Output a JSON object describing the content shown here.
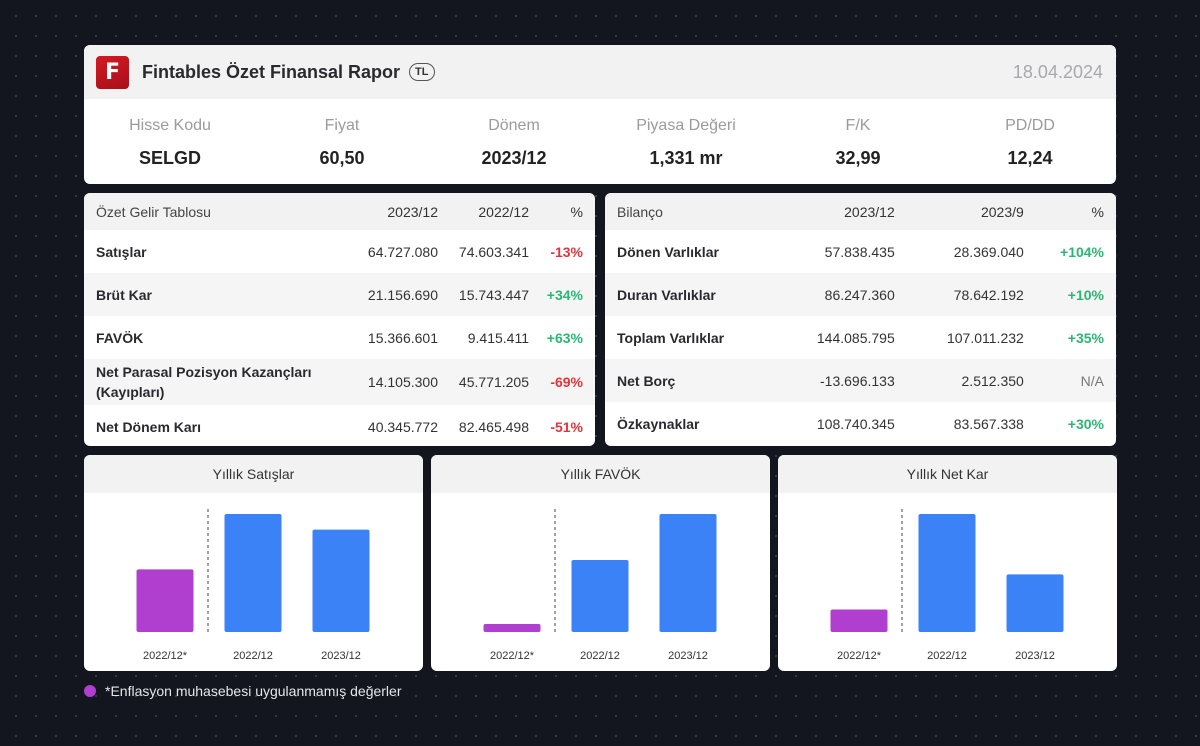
{
  "header": {
    "logo_letter": "F",
    "title": "Fintables Özet Finansal Rapor",
    "currency": "TL",
    "date": "18.04.2024"
  },
  "summary": [
    {
      "label": "Hisse Kodu",
      "value": "SELGD"
    },
    {
      "label": "Fiyat",
      "value": "60,50"
    },
    {
      "label": "Dönem",
      "value": "2023/12"
    },
    {
      "label": "Piyasa Değeri",
      "value": "1,331 mr"
    },
    {
      "label": "F/K",
      "value": "32,99"
    },
    {
      "label": "PD/DD",
      "value": "12,24"
    }
  ],
  "income": {
    "title": "Özet Gelir Tablosu",
    "col1": "2023/12",
    "col2": "2022/12",
    "col3": "%",
    "rows": [
      {
        "name": "Satışlar",
        "v1": "64.727.080",
        "v2": "74.603.341",
        "pct": "-13%"
      },
      {
        "name": "Brüt Kar",
        "v1": "21.156.690",
        "v2": "15.743.447",
        "pct": "+34%"
      },
      {
        "name": "FAVÖK",
        "v1": "15.366.601",
        "v2": "9.415.411",
        "pct": "+63%"
      },
      {
        "name": "Net Parasal Pozisyon Kazançları (Kayıpları)",
        "v1": "14.105.300",
        "v2": "45.771.205",
        "pct": "-69%"
      },
      {
        "name": "Net Dönem Karı",
        "v1": "40.345.772",
        "v2": "82.465.498",
        "pct": "-51%"
      }
    ]
  },
  "balance": {
    "title": "Bilanço",
    "col1": "2023/12",
    "col2": "2023/9",
    "col3": "%",
    "rows": [
      {
        "name": "Dönen Varlıklar",
        "v1": "57.838.435",
        "v2": "28.369.040",
        "pct": "+104%"
      },
      {
        "name": "Duran Varlıklar",
        "v1": "86.247.360",
        "v2": "78.642.192",
        "pct": "+10%"
      },
      {
        "name": "Toplam Varlıklar",
        "v1": "144.085.795",
        "v2": "107.011.232",
        "pct": "+35%"
      },
      {
        "name": "Net Borç",
        "v1": "-13.696.133",
        "v2": "2.512.350",
        "pct": "N/A"
      },
      {
        "name": "Özkaynaklar",
        "v1": "108.740.345",
        "v2": "83.567.338",
        "pct": "+30%"
      }
    ]
  },
  "colors": {
    "inflation_unadjusted": "#b03fcf",
    "bar": "#3b82f6",
    "positive": "#2ab673",
    "negative": "#e0353b"
  },
  "chart_data": [
    {
      "type": "bar",
      "title": "Yıllık Satışlar",
      "categories": [
        "2022/12*",
        "2022/12",
        "2023/12"
      ],
      "values": [
        39.6,
        74.6,
        64.7
      ],
      "ylim": [
        0,
        74.6
      ]
    },
    {
      "type": "bar",
      "title": "Yıllık FAVÖK",
      "categories": [
        "2022/12*",
        "2022/12",
        "2023/12"
      ],
      "values": [
        0.6,
        9.4,
        15.4
      ],
      "ylim": [
        0,
        15.4
      ]
    },
    {
      "type": "bar",
      "title": "Yıllık Net Kar",
      "categories": [
        "2022/12*",
        "2022/12",
        "2023/12"
      ],
      "values": [
        15.7,
        82.5,
        40.3
      ],
      "ylim": [
        0,
        82.5
      ]
    }
  ],
  "footnote": "*Enflasyon muhasebesi uygulanmamış değerler"
}
